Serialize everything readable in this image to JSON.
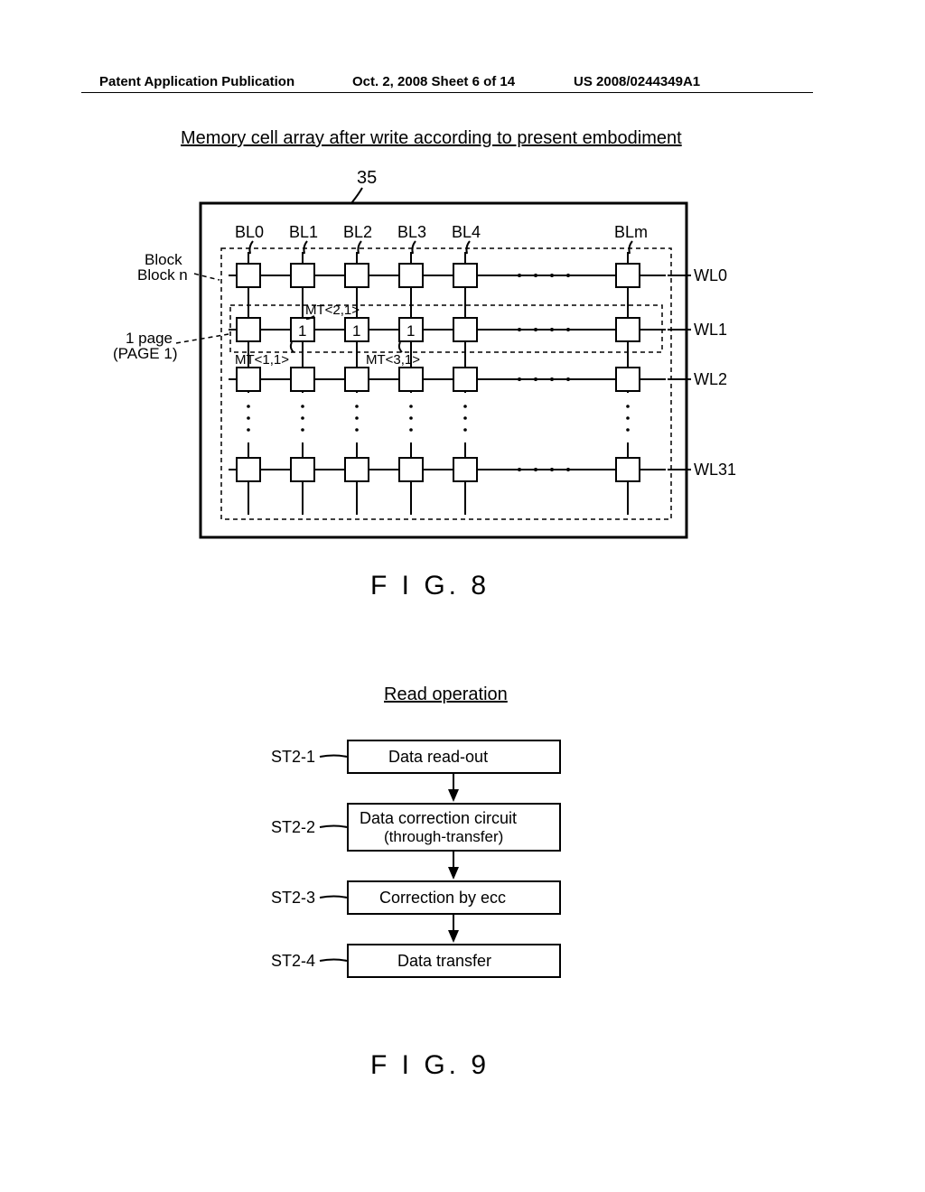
{
  "header": {
    "left": "Patent Application Publication",
    "mid": "Oct. 2, 2008   Sheet 6 of 14",
    "right": "US 2008/0244349A1"
  },
  "fig8": {
    "title": "Memory cell array after write according to present  embodiment",
    "ref": "35",
    "block_a": "Block",
    "block_b": "Block n",
    "page_a": "1 page",
    "page_b": "(PAGE 1)",
    "bl": [
      "BL0",
      "BL1",
      "BL2",
      "BL3",
      "BL4",
      "BLm"
    ],
    "wl": [
      "WL0",
      "WL1",
      "WL2",
      "WL31"
    ],
    "mt1": "MT<2,1>",
    "mt2": "MT<1,1>",
    "mt3": "MT<3,1>",
    "row1_values": [
      "1",
      "1",
      "1"
    ],
    "caption": "F I G. 8"
  },
  "fig9": {
    "title": "Read operation",
    "steps": [
      {
        "id": "ST2-1",
        "label_a": "Data read-out",
        "label_b": ""
      },
      {
        "id": "ST2-2",
        "label_a": "Data correction circuit",
        "label_b": "(through-transfer)"
      },
      {
        "id": "ST2-3",
        "label_a": "Correction by ecc",
        "label_b": ""
      },
      {
        "id": "ST2-4",
        "label_a": "Data transfer",
        "label_b": ""
      }
    ],
    "caption": "F I G. 9"
  }
}
